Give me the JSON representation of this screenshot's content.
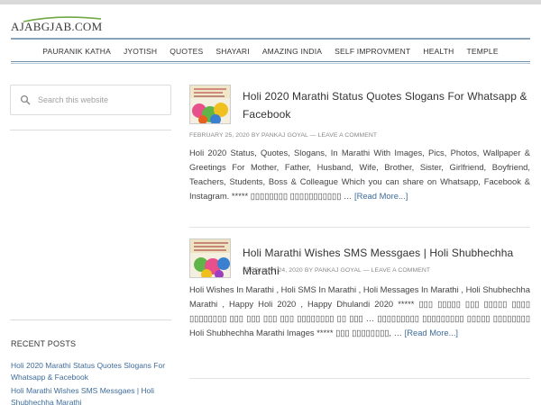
{
  "site": {
    "logo_text": "AJABGJAB.COM"
  },
  "nav": {
    "items": [
      "PAURANIK KATHA",
      "JYOTISH",
      "QUOTES",
      "SHAYARI",
      "AMAZING INDIA",
      "SELF IMPROVMENT",
      "HEALTH",
      "TEMPLE"
    ]
  },
  "search": {
    "placeholder": "Search this website"
  },
  "sidebar": {
    "recent_title": "RECENT POSTS",
    "recent_posts": [
      "Holi 2020 Marathi Status Quotes Slogans For Whatsapp & Facebook",
      "Holi Marathi Wishes SMS Messgaes | Holi Shubhechha Marathi"
    ]
  },
  "posts": [
    {
      "title": "Holi 2020 Marathi Status Quotes Slogans For Whatsapp & Facebook",
      "date": "FEBRUARY 25, 2020",
      "by": "BY",
      "author": "PANKAJ GOYAL",
      "separator": "—",
      "comment_link": "LEAVE A COMMENT",
      "excerpt": "Holi 2020 Status, Quotes, Slogans, In Marathi With Images, Pics, Photos, Wallpaper & Greetings For Mother, Father, Husband, Wife, Brother, Sister, Girlfriend, Boyfriend, Teachers, Students, Boss & Colleague Which you can share on Whatsapp, Facebook & Instagram. ***** ▯▯▯▯▯▯▯▯ ▯▯▯▯▯▯▯▯▯▯▯ …",
      "read_more": "[Read More...]"
    },
    {
      "title": "Holi Marathi Wishes SMS Messgaes | Holi Shubhechha Marathi",
      "date": "FEBRUARY 24, 2020",
      "by": "BY",
      "author": "PANKAJ GOYAL",
      "separator": "—",
      "comment_link": "LEAVE A COMMENT",
      "excerpt": "Holi Wishes In Marathi , Holi SMS In Marathi , Holi Messages In Marathi , Holi Shubhechha Marathi , Happy Holi 2020 , Happy Dhulandi 2020 ***** ▯▯▯ ▯▯▯▯▯ ▯▯▯ ▯▯▯▯▯ ▯▯▯▯ ▯▯▯▯▯▯▯▯ ▯▯▯ ▯▯▯ ▯▯▯ ▯▯▯ ▯▯▯▯▯▯▯▯ ▯▯ ▯▯▯ … ▯▯▯▯▯▯▯▯▯ ▯▯▯▯▯▯▯▯▯ ▯▯▯▯▯ ▯▯▯▯▯▯▯▯ Holi Shubhechha Marathi Images ***** ▯▯▯ ▯▯▯▯▯▯▯▯, …",
      "read_more": "[Read More...]"
    }
  ],
  "colors": {
    "link": "#3f6c9b",
    "rule": "#6f8fa8",
    "thumb_pink": "#e8508c",
    "thumb_green": "#5fb548"
  }
}
